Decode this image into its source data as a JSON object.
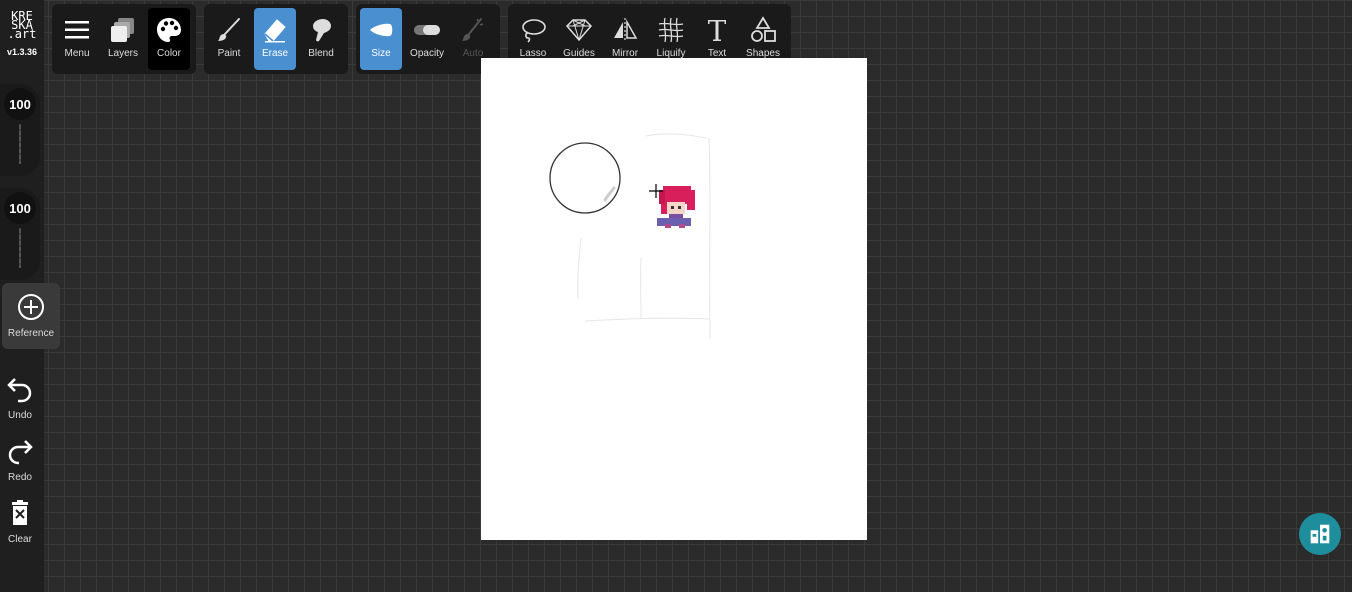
{
  "app": {
    "logo_lines": [
      "KRE",
      "SKA",
      ".art"
    ],
    "version": "v1.3.36"
  },
  "toolbar_main": [
    {
      "label": "Menu",
      "icon": "hamburger-icon"
    },
    {
      "label": "Layers",
      "icon": "layers-icon"
    },
    {
      "label": "Color",
      "icon": "palette-icon",
      "state": "active"
    }
  ],
  "toolbar_brush": [
    {
      "label": "Paint",
      "icon": "brush-icon"
    },
    {
      "label": "Erase",
      "icon": "eraser-icon",
      "state": "active"
    },
    {
      "label": "Blend",
      "icon": "blend-icon"
    }
  ],
  "toolbar_settings": [
    {
      "label": "Size",
      "icon": "size-icon",
      "state": "active"
    },
    {
      "label": "Opacity",
      "icon": "opacity-icon"
    },
    {
      "label": "Auto",
      "icon": "auto-icon",
      "state": "disabled"
    }
  ],
  "toolbar_tools": [
    {
      "label": "Lasso",
      "icon": "lasso-icon"
    },
    {
      "label": "Guides",
      "icon": "guides-icon"
    },
    {
      "label": "Mirror",
      "icon": "mirror-icon"
    },
    {
      "label": "Liquify",
      "icon": "liquify-icon"
    },
    {
      "label": "Text",
      "icon": "text-icon"
    },
    {
      "label": "Shapes",
      "icon": "shapes-icon"
    }
  ],
  "sliders": {
    "size_value": "100",
    "opacity_value": "100"
  },
  "side": {
    "reference": "Reference",
    "undo": "Undo",
    "redo": "Redo",
    "clear": "Clear"
  },
  "colors": {
    "accent": "#4a8fd0",
    "help": "#1e8e9c",
    "sprite_hair": "#d81e5b"
  }
}
